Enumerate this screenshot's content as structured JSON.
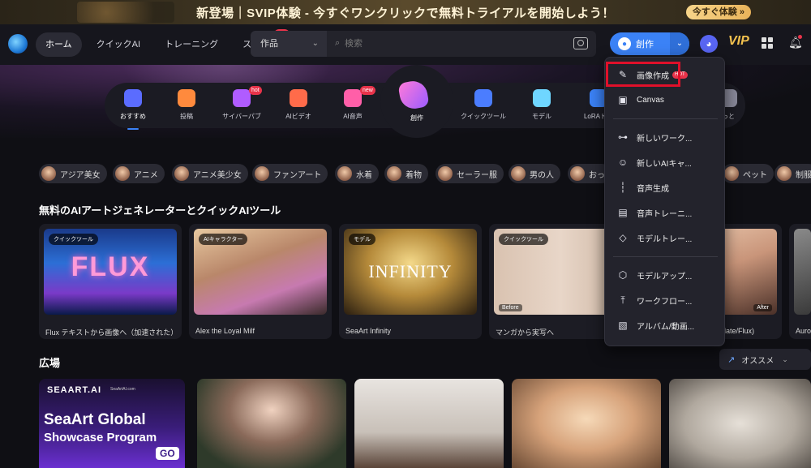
{
  "promo": {
    "text": "新登場｜SVIP体験 - 今すぐワンクリックで無料トライアルを開始しよう！",
    "button": "今すぐ体験 »"
  },
  "header": {
    "nav": [
      {
        "label": "ホーム",
        "active": true
      },
      {
        "label": "クイックAI"
      },
      {
        "label": "トレーニング"
      },
      {
        "label": "スタジオ",
        "badge": "hot"
      }
    ],
    "search": {
      "category": "作品",
      "placeholder": "検索"
    },
    "create_label": "創作",
    "vip_label": "VIP"
  },
  "categories": [
    {
      "label": "おすすめ",
      "color": "#5b6cff",
      "active": true
    },
    {
      "label": "投稿",
      "color": "#ff8a3d"
    },
    {
      "label": "サイバーパブ",
      "color": "#b05cff",
      "badge": "hot"
    },
    {
      "label": "AIビデオ",
      "color": "#ff6b4a"
    },
    {
      "label": "AI音声",
      "color": "#ff5fa8",
      "badge": "new"
    },
    {
      "label": "クイックツール",
      "color": "#4b7dff"
    },
    {
      "label": "モデル",
      "color": "#6fd6ff"
    },
    {
      "label": "LoRAトレ",
      "color": "#3b82f6"
    },
    {
      "label": "っと",
      "color": "#888899"
    }
  ],
  "create_bubble": "創作",
  "chips": [
    "アジア美女",
    "アニメ",
    "アニメ美少女",
    "ファンアート",
    "水着",
    "着物",
    "セーラー服",
    "男の人",
    "おっ",
    "ペット",
    "制服"
  ],
  "tools_section": {
    "title": "無料のAIアートジェネレーターとクイックAIツール"
  },
  "tool_cards": [
    {
      "tag": "クイックツール",
      "caption": "Flux テキストから画像へ（加速された）",
      "art_text": "FLUX"
    },
    {
      "tag": "AIキャラクター",
      "caption": "Alex the Loyal Milf"
    },
    {
      "tag": "モデル",
      "caption": "SeaArt Infinity",
      "art_text": "INFINITY"
    },
    {
      "tag": "クイックツール",
      "caption": "マンガから実写へ",
      "before_label": "Before",
      "after_label": "Af"
    },
    {
      "tag": "",
      "caption": "date/Flux)",
      "after_label": "After"
    },
    {
      "tag": "",
      "caption": "Auro"
    }
  ],
  "dropdown": {
    "items": [
      {
        "label": "画像作成",
        "icon": "brush-icon",
        "badge": "HOT"
      },
      {
        "label": "Canvas",
        "icon": "canvas-icon"
      },
      {
        "label": "新しいワーク...",
        "icon": "workflow-icon"
      },
      {
        "label": "新しいAIキャ...",
        "icon": "ai-character-icon"
      },
      {
        "label": "音声生成",
        "icon": "waveform-icon"
      },
      {
        "label": "音声トレーニ...",
        "icon": "audio-file-icon"
      },
      {
        "label": "モデルトレー...",
        "icon": "cube-icon"
      },
      {
        "label": "モデルアップ...",
        "icon": "model-upload-icon"
      },
      {
        "label": "ワークフロー...",
        "icon": "upload-icon"
      },
      {
        "label": "アルバム/動画...",
        "icon": "album-icon"
      }
    ]
  },
  "plaza": {
    "title": "広場",
    "sort_label": "オススメ",
    "showcase": {
      "brand": "SEAART.AI",
      "url": "SeaArtAI.com",
      "headline1": "SeaArt Global",
      "headline2": "Showcase Program",
      "go": "GO"
    }
  },
  "colors": {
    "accent": "#3b82f6",
    "highlight": "#e0102a",
    "hot": "#e8334a"
  }
}
